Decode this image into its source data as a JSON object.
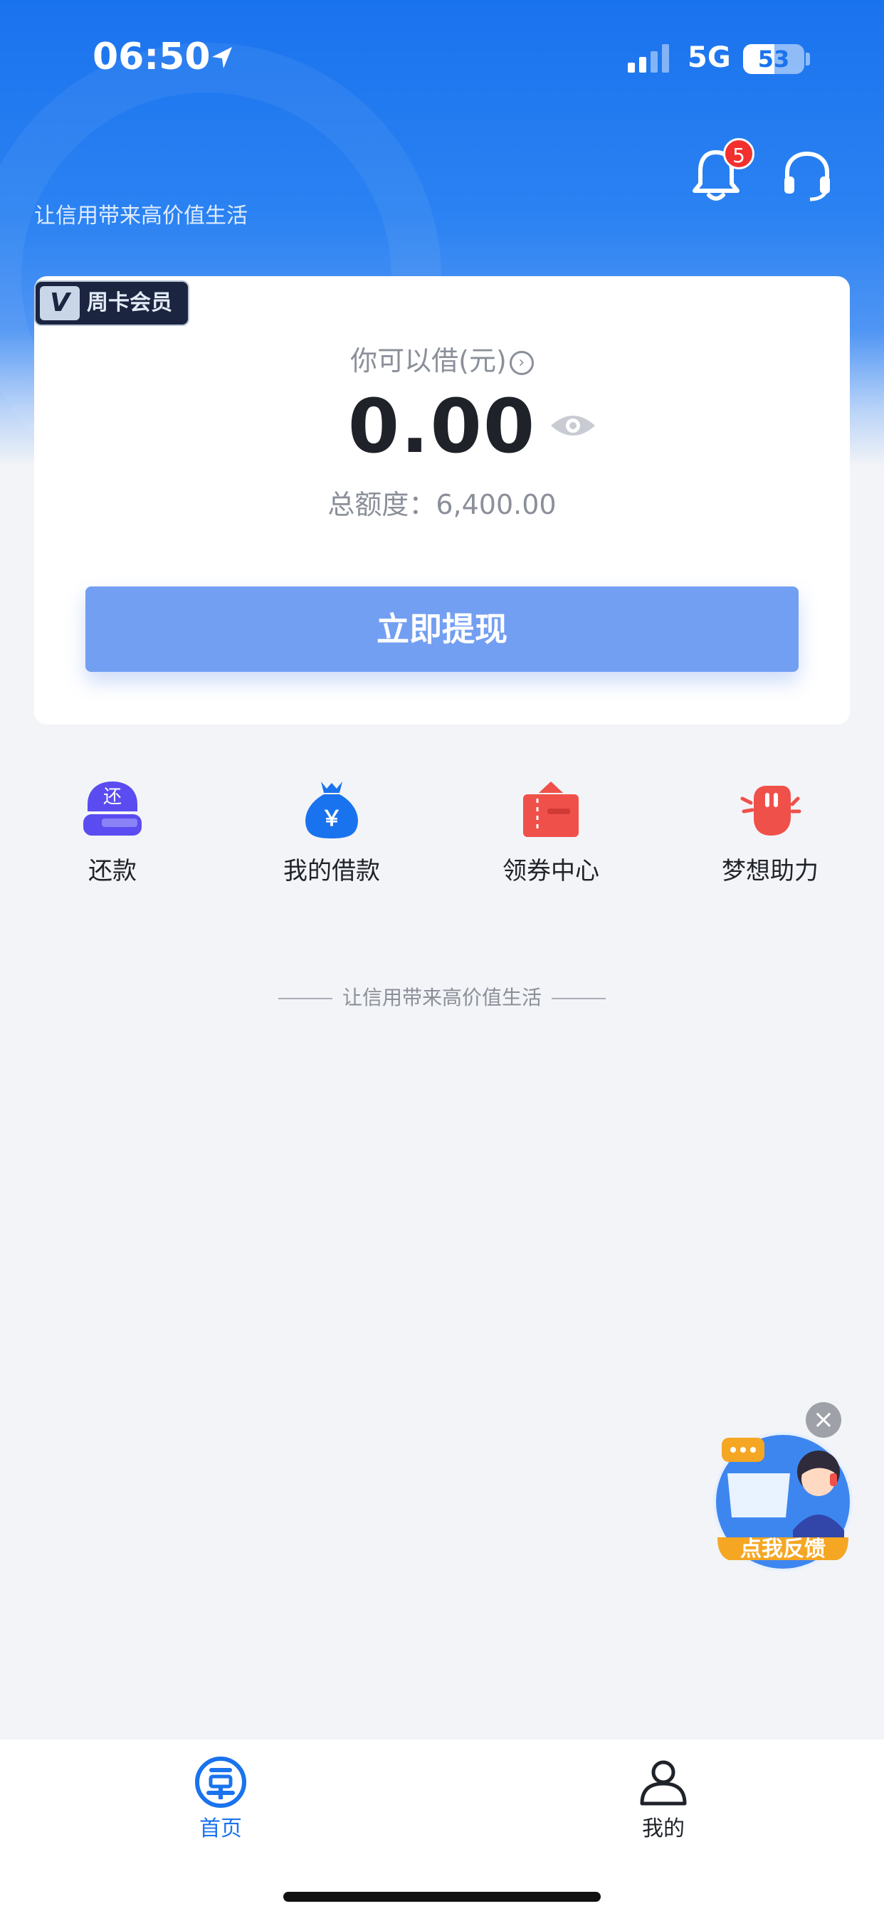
{
  "status_bar": {
    "time": "06:50",
    "network": "5G",
    "battery": "53"
  },
  "header": {
    "tagline": "让信用带来高价值生活",
    "notification_count": "5"
  },
  "card": {
    "vip_badge": "周卡会员",
    "vip_logo": "V",
    "can_borrow_label": "你可以借(元)",
    "amount": "0.00",
    "total_limit": "总额度：6,400.00",
    "withdraw_button": "立即提现"
  },
  "actions": [
    {
      "label": "还款",
      "icon": "repay-icon",
      "glyph": "还",
      "color": "#5a4cf0"
    },
    {
      "label": "我的借款",
      "icon": "money-bag-icon",
      "glyph": "￥",
      "color": "#1a73ee"
    },
    {
      "label": "领券中心",
      "icon": "coupon-icon",
      "color": "#f0504a"
    },
    {
      "label": "梦想助力",
      "icon": "fist-icon",
      "color": "#f0504a"
    }
  ],
  "slogan": "让信用带来高价值生活",
  "floating": {
    "label": "点我反馈"
  },
  "tabbar": {
    "items": [
      {
        "label": "首页",
        "active": true
      },
      {
        "label": "我的",
        "active": false
      }
    ]
  },
  "colors": {
    "primary": "#1a73ee",
    "button": "#739ff2",
    "badge": "#f2302e"
  }
}
